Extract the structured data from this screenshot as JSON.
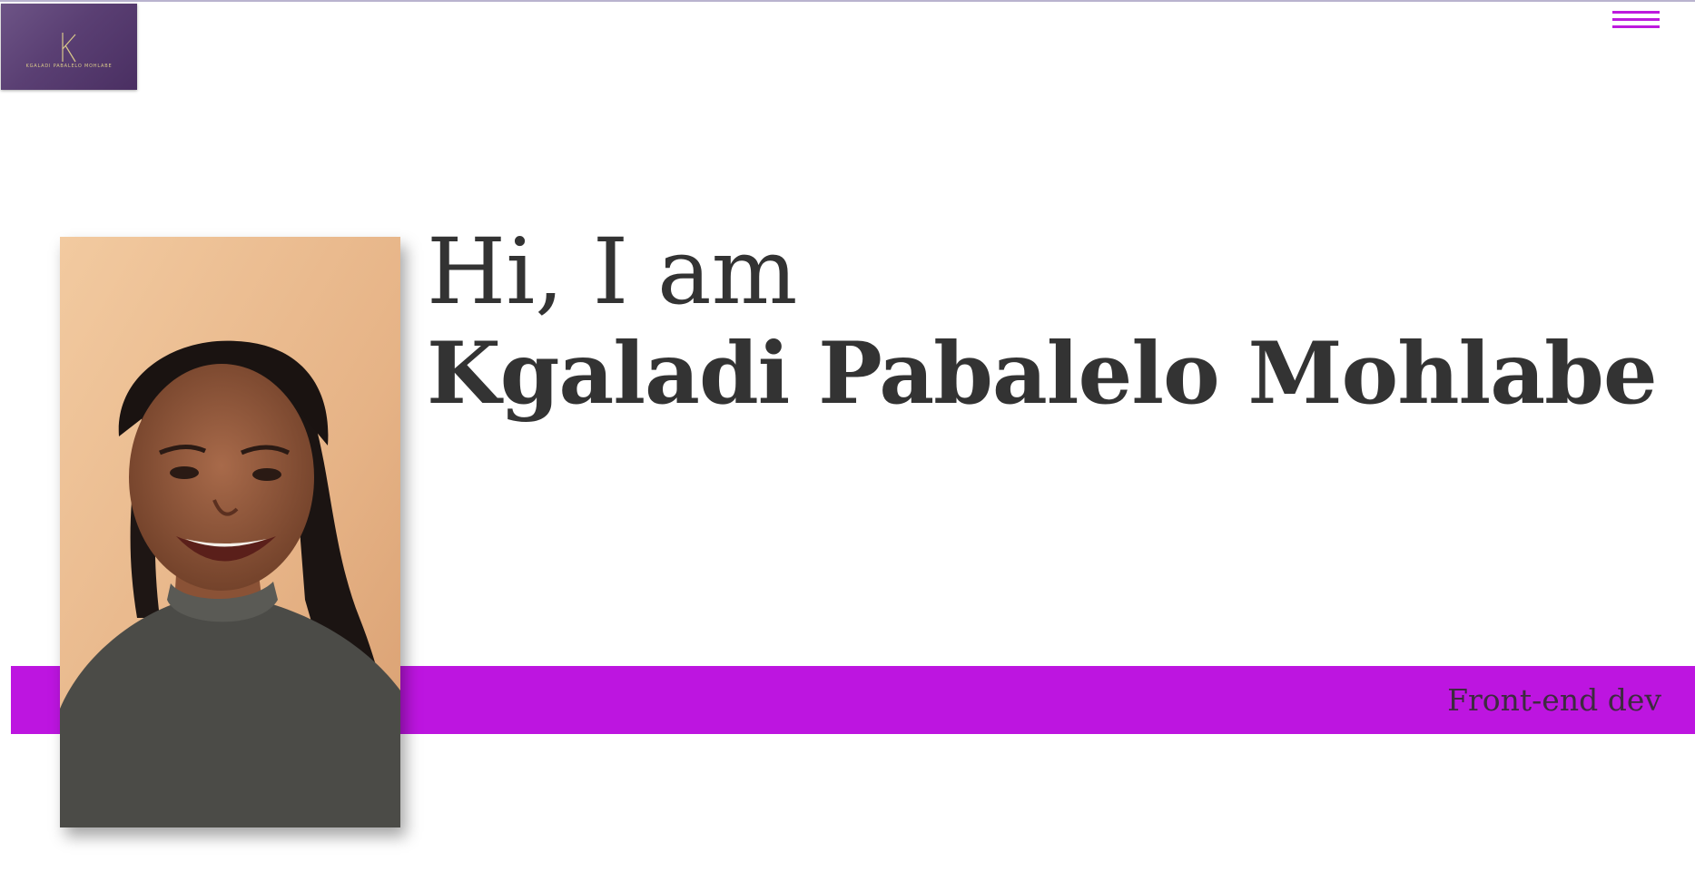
{
  "header": {
    "logo": {
      "monogram": "K",
      "text": "KGALADI PABALELO MOHLABE"
    },
    "menu_icon": "hamburger-icon"
  },
  "hero": {
    "greeting": "Hi, I am",
    "name": "Kgaladi Pabalelo Mohlabe",
    "role": "Front-end dev",
    "photo": "profile-photo"
  },
  "colors": {
    "accent": "#bd15e0",
    "logo_bg": "#5a3f73",
    "text": "#333333"
  }
}
